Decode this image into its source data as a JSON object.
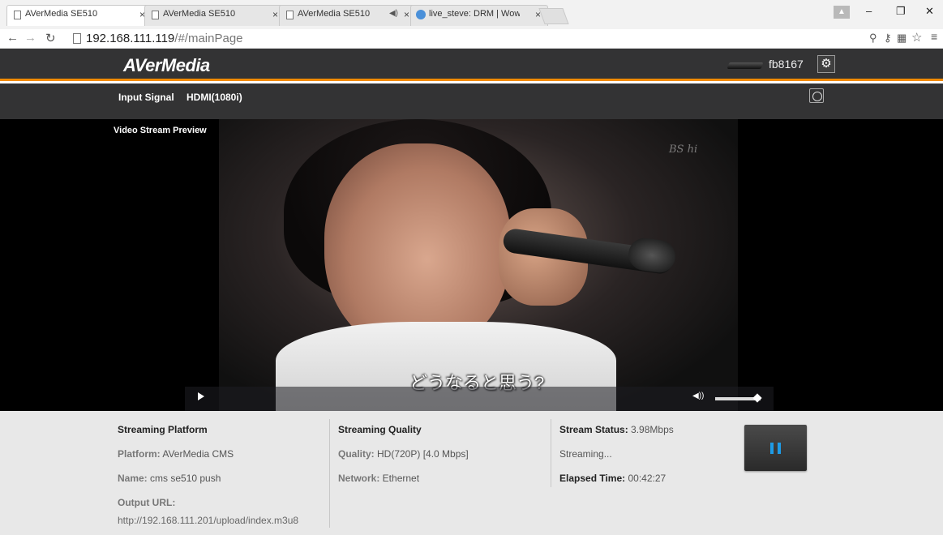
{
  "browser": {
    "tabs": [
      {
        "title": "AVerMedia SE510",
        "active": true
      },
      {
        "title": "AVerMedia SE510",
        "active": false
      },
      {
        "title": "AVerMedia SE510",
        "active": false,
        "audio": true
      },
      {
        "title": "live_steve: DRM | Wowza",
        "active": false
      }
    ],
    "tab_close": "×",
    "url_host": "192.168.111.119",
    "url_path": "/#/mainPage",
    "icons": [
      "back-arrow",
      "forward-arrow",
      "reload",
      "zoom",
      "key",
      "translate",
      "star",
      "menu"
    ],
    "window_controls": {
      "minimize": "–",
      "restore": "❐",
      "close": "✕"
    }
  },
  "header": {
    "brand": "AVerMedia",
    "device_name": "fb8167",
    "accent_color": "#f28a00"
  },
  "signal": {
    "label": "Input Signal",
    "value": "HDMI(1080i)"
  },
  "video": {
    "preview_label": "Video Stream Preview",
    "watermark": "BS hi",
    "subtitle": "どうなると思う?",
    "volume": 0.85
  },
  "platform": {
    "heading": "Streaming Platform",
    "platform_key": "Platform:",
    "platform_value": " AVerMedia CMS",
    "name_key": "Name:",
    "name_value": " cms se510 push",
    "url_key": "Output URL:",
    "url_value": "http://192.168.111.201/upload/index.m3u8"
  },
  "quality": {
    "heading": "Streaming Quality",
    "quality_key": "Quality:",
    "quality_value": " HD(720P) [4.0 Mbps]",
    "network_key": "Network:",
    "network_value": " Ethernet"
  },
  "status": {
    "heading": "Stream Status:",
    "heading_value": " 3.98Mbps",
    "state": "Streaming...",
    "elapsed_key": "Elapsed Time:",
    "elapsed_value": " 00:42:27"
  }
}
